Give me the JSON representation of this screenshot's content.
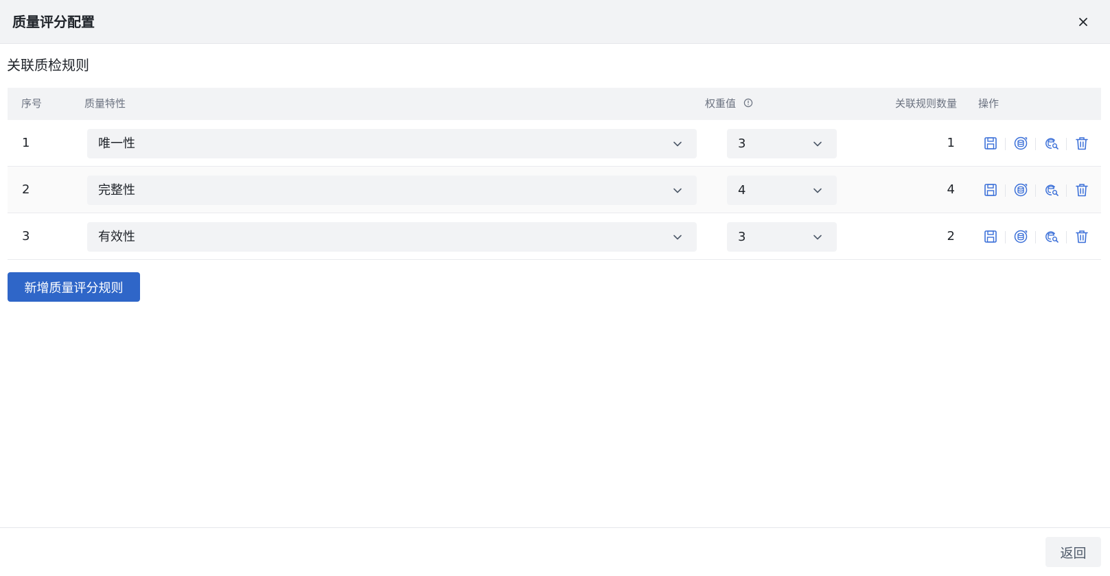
{
  "dialog": {
    "title": "质量评分配置",
    "close_icon": "close-icon"
  },
  "section": {
    "title": "关联质检规则"
  },
  "table": {
    "headers": {
      "index": "序号",
      "quality": "质量特性",
      "weight": "权重值",
      "rule_count": "关联规则数量",
      "actions": "操作"
    },
    "rows": [
      {
        "index": "1",
        "quality": "唯一性",
        "weight": "3",
        "rule_count": "1"
      },
      {
        "index": "2",
        "quality": "完整性",
        "weight": "4",
        "rule_count": "4"
      },
      {
        "index": "3",
        "quality": "有效性",
        "weight": "3",
        "rule_count": "2"
      }
    ],
    "action_icons": [
      "save-icon",
      "database-refresh-icon",
      "database-search-icon",
      "trash-icon"
    ]
  },
  "add_button": {
    "label": "新增质量评分规则"
  },
  "footer": {
    "back_label": "返回"
  },
  "colors": {
    "primary": "#2f66c8",
    "icon_blue": "#3a6fd8",
    "header_bg": "#f2f3f5"
  }
}
